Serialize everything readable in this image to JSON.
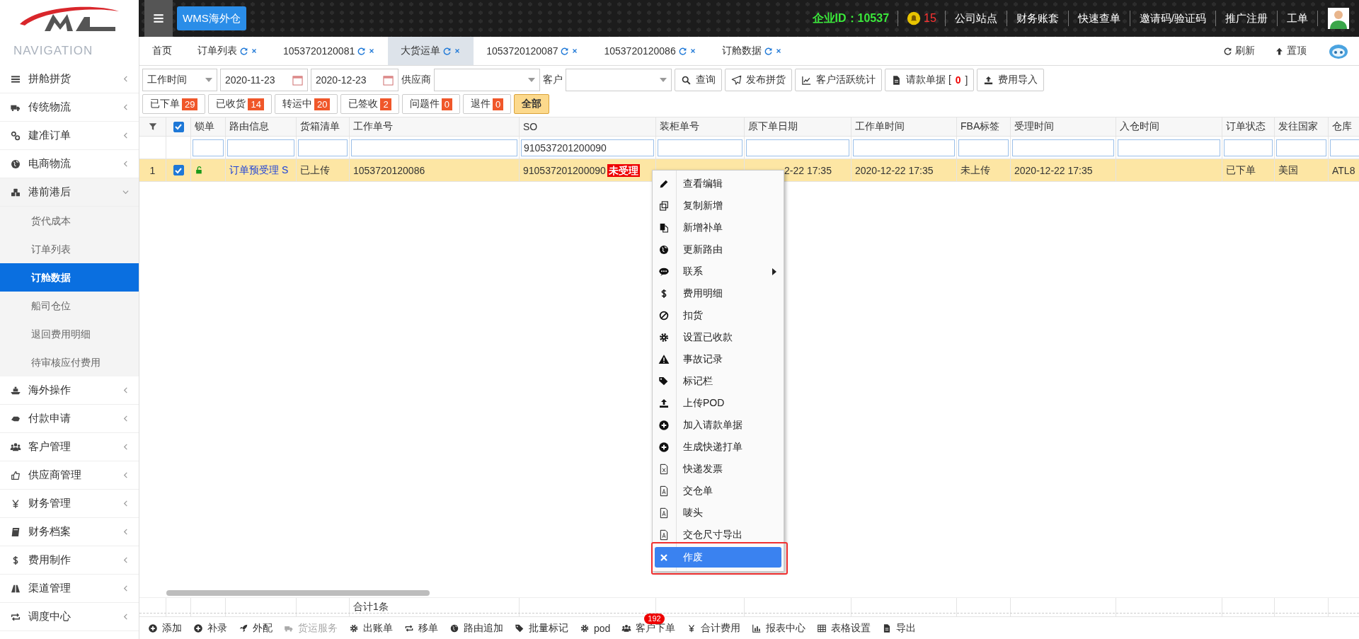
{
  "brand": {
    "button": "WMS海外仓"
  },
  "topbar": {
    "company_id": "企业ID：10537",
    "notifications": "15",
    "links": [
      "公司站点",
      "财务账套",
      "快速查单",
      "邀请码/验证码",
      "推广注册",
      "工单"
    ]
  },
  "sidebar": {
    "heading": "NAVIGATION",
    "items": [
      {
        "label": "拼舱拼货",
        "expanded": false
      },
      {
        "label": "传统物流",
        "expanded": false
      },
      {
        "label": "建准订单",
        "expanded": false
      },
      {
        "label": "电商物流",
        "expanded": false
      },
      {
        "label": "港前港后",
        "expanded": true,
        "children": [
          {
            "label": "货代成本",
            "selected": false
          },
          {
            "label": "订单列表",
            "selected": false
          },
          {
            "label": "订舱数据",
            "selected": true
          },
          {
            "label": "船司仓位",
            "selected": false
          },
          {
            "label": "退回费用明细",
            "selected": false
          },
          {
            "label": "待审核应付费用",
            "selected": false
          }
        ]
      },
      {
        "label": "海外操作",
        "expanded": false
      },
      {
        "label": "付款申请",
        "expanded": false
      },
      {
        "label": "客户管理",
        "expanded": false
      },
      {
        "label": "供应商管理",
        "expanded": false
      },
      {
        "label": "财务管理",
        "expanded": false
      },
      {
        "label": "财务档案",
        "expanded": false
      },
      {
        "label": "费用制作",
        "expanded": false
      },
      {
        "label": "渠道管理",
        "expanded": false
      },
      {
        "label": "调度中心",
        "expanded": false
      }
    ]
  },
  "tabs": [
    {
      "label": "首页",
      "selected": false,
      "closable": false
    },
    {
      "label": "订单列表",
      "selected": false,
      "closable": true
    },
    {
      "label": "1053720120081",
      "selected": false,
      "closable": true
    },
    {
      "label": "大货运单",
      "selected": true,
      "closable": true
    },
    {
      "label": "1053720120087",
      "selected": false,
      "closable": true
    },
    {
      "label": "1053720120086",
      "selected": false,
      "closable": true
    },
    {
      "label": "订舱数据",
      "selected": false,
      "closable": true
    }
  ],
  "tab_actions": [
    "刷新",
    "置顶"
  ],
  "filters": {
    "time_field": "工作时间",
    "date_from": "2020-11-23",
    "date_to": "2020-12-23",
    "supplier_label": "供应商",
    "customer_label": "客户",
    "buttons": [
      "查询",
      "发布拼货",
      "客户活跃统计"
    ],
    "request_button": {
      "label": "请款单据",
      "open": "[",
      "count": "0",
      "close": "]"
    },
    "import_button": "费用导入"
  },
  "status_filters": [
    {
      "label": "已下单",
      "count": "29",
      "selected": false
    },
    {
      "label": "已收货",
      "count": "14",
      "selected": false
    },
    {
      "label": "转运中",
      "count": "20",
      "selected": false
    },
    {
      "label": "已签收",
      "count": "2",
      "selected": false
    },
    {
      "label": "问题件",
      "count": "0",
      "selected": false
    },
    {
      "label": "退件",
      "count": "0",
      "selected": false
    },
    {
      "label": "全部",
      "selected": true
    }
  ],
  "table": {
    "columns": [
      "锁单",
      "路由信息",
      "货箱清单",
      "工作单号",
      "SO",
      "装柜单号",
      "原下单日期",
      "工作单时间",
      "FBA标签",
      "受理时间",
      "入仓时间",
      "订单状态",
      "发往国家",
      "仓库"
    ],
    "so_filter": "910537201200090",
    "rows": [
      {
        "index": "1",
        "selected": true,
        "checked": true,
        "route": "订单预受理 S",
        "packing_list": "已上传",
        "work_order_no": "1053720120086",
        "so": "910537201200090",
        "so_status": "未受理",
        "order_date": "2-22 17:35",
        "work_order_time": "2020-12-22 17:35",
        "fba_label": "未上传",
        "accepted_time": "2020-12-22 17:35",
        "order_status": "已下单",
        "country": "美国",
        "warehouse": "ATL8"
      }
    ],
    "header_checked": true,
    "total": "合计1条"
  },
  "context_menu": {
    "items": [
      {
        "label": "查看编辑",
        "submenu": false,
        "selected": false
      },
      {
        "label": "复制新增",
        "submenu": false,
        "selected": false
      },
      {
        "label": "新增补单",
        "submenu": false,
        "selected": false
      },
      {
        "label": "更新路由",
        "submenu": false,
        "selected": false
      },
      {
        "label": "联系",
        "submenu": true,
        "selected": false
      },
      {
        "label": "费用明细",
        "submenu": false,
        "selected": false
      },
      {
        "label": "扣货",
        "submenu": false,
        "selected": false
      },
      {
        "label": "设置已收款",
        "submenu": false,
        "selected": false
      },
      {
        "label": "事故记录",
        "submenu": false,
        "selected": false
      },
      {
        "label": "标记栏",
        "submenu": false,
        "selected": false
      },
      {
        "label": "上传POD",
        "submenu": false,
        "selected": false
      },
      {
        "label": "加入请款单据",
        "submenu": false,
        "selected": false
      },
      {
        "label": "生成快递打单",
        "submenu": false,
        "selected": false
      },
      {
        "label": "快递发票",
        "submenu": false,
        "selected": false
      },
      {
        "label": "交仓单",
        "submenu": false,
        "selected": false
      },
      {
        "label": "唛头",
        "submenu": false,
        "selected": false
      },
      {
        "label": "交仓尺寸导出",
        "submenu": false,
        "selected": false
      },
      {
        "label": "作废",
        "submenu": false,
        "selected": true
      }
    ]
  },
  "toolbar": [
    {
      "label": "添加",
      "disabled": false
    },
    {
      "label": "补录",
      "disabled": false
    },
    {
      "label": "外配",
      "disabled": false
    },
    {
      "label": "货运服务",
      "disabled": true
    },
    {
      "label": "出账单",
      "disabled": false
    },
    {
      "label": "移单",
      "disabled": false
    },
    {
      "label": "路由追加",
      "disabled": false
    },
    {
      "label": "批量标记",
      "disabled": false
    },
    {
      "label": "pod",
      "disabled": false
    },
    {
      "label": "客户下单",
      "disabled": false,
      "badge": "192"
    },
    {
      "label": "合计费用",
      "disabled": false
    },
    {
      "label": "报表中心",
      "disabled": false
    },
    {
      "label": "表格设置",
      "disabled": false
    },
    {
      "label": "导出",
      "disabled": false
    }
  ]
}
